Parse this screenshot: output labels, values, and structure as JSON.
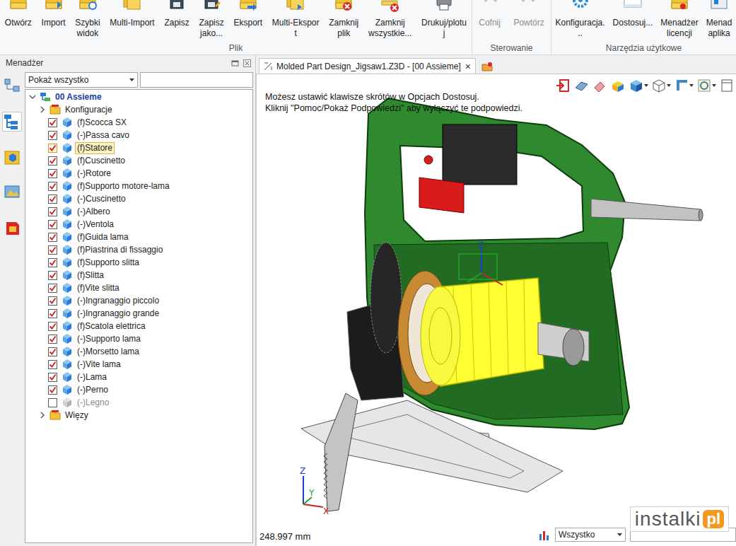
{
  "ribbon": {
    "groups": [
      {
        "label": "Plik",
        "buttons": [
          {
            "label": "Otwórz",
            "disabled": false
          },
          {
            "label": "Import",
            "disabled": false
          },
          {
            "label": "Szybki\nwidok",
            "disabled": false
          },
          {
            "label": "Multi-Import",
            "disabled": false
          },
          {
            "label": "Zapisz",
            "disabled": false
          },
          {
            "label": "Zapisz\njako...",
            "disabled": false
          },
          {
            "label": "Eksport",
            "disabled": false
          },
          {
            "label": "Multi-Ekspor\nt",
            "disabled": false
          },
          {
            "label": "Zamknij\nplik",
            "disabled": false
          },
          {
            "label": "Zamknij\nwszystkie...",
            "disabled": false
          },
          {
            "label": "Drukuj/plotu\nj",
            "disabled": false
          }
        ]
      },
      {
        "label": "Sterowanie",
        "buttons": [
          {
            "label": "Cofnij",
            "disabled": true
          },
          {
            "label": "Powtórz",
            "disabled": true
          }
        ]
      },
      {
        "label": "Narzędzia użytkowe",
        "buttons": [
          {
            "label": "Konfiguracja.\n..",
            "disabled": false
          },
          {
            "label": "Dostosuj...",
            "disabled": false
          },
          {
            "label": "Menadżer\nlicencji",
            "disabled": false
          },
          {
            "label": "Menad\naplika",
            "disabled": false
          }
        ]
      }
    ]
  },
  "manager": {
    "title": "Menadżer",
    "filter": "Pokaż wszystko",
    "tree": [
      {
        "label": "00 Assieme",
        "kind": "assembly",
        "expanded": true,
        "selected": false
      },
      {
        "label": "Konfiguracje",
        "kind": "folder",
        "expanded": false,
        "selected": false
      },
      {
        "label": "(f)Scocca SX",
        "kind": "part",
        "checked": true,
        "selected": false,
        "disabled": false
      },
      {
        "label": "(-)Passa cavo",
        "kind": "part",
        "checked": true,
        "selected": false,
        "disabled": false
      },
      {
        "label": "(f)Statore",
        "kind": "part",
        "checked": true,
        "selected": true,
        "disabled": false
      },
      {
        "label": "(f)Cuscinetto",
        "kind": "part",
        "checked": true,
        "selected": false,
        "disabled": false
      },
      {
        "label": "(-)Rotore",
        "kind": "part",
        "checked": true,
        "selected": false,
        "disabled": false
      },
      {
        "label": "(f)Supporto motore-lama",
        "kind": "part",
        "checked": true,
        "selected": false,
        "disabled": false
      },
      {
        "label": "(-)Cuscinetto",
        "kind": "part",
        "checked": true,
        "selected": false,
        "disabled": false
      },
      {
        "label": "(-)Albero",
        "kind": "part",
        "checked": true,
        "selected": false,
        "disabled": false
      },
      {
        "label": "(-)Ventola",
        "kind": "part",
        "checked": true,
        "selected": false,
        "disabled": false
      },
      {
        "label": "(f)Guida lama",
        "kind": "part",
        "checked": true,
        "selected": false,
        "disabled": false
      },
      {
        "label": "(f)Piastrina di fissaggio",
        "kind": "part",
        "checked": true,
        "selected": false,
        "disabled": false
      },
      {
        "label": "(f)Supporto slitta",
        "kind": "part",
        "checked": true,
        "selected": false,
        "disabled": false
      },
      {
        "label": "(f)Slitta",
        "kind": "part",
        "checked": true,
        "selected": false,
        "disabled": false
      },
      {
        "label": "(f)Vite slitta",
        "kind": "part",
        "checked": true,
        "selected": false,
        "disabled": false
      },
      {
        "label": "(-)Ingranaggio piccolo",
        "kind": "part",
        "checked": true,
        "selected": false,
        "disabled": false
      },
      {
        "label": "(-)Ingranaggio grande",
        "kind": "part",
        "checked": true,
        "selected": false,
        "disabled": false
      },
      {
        "label": "(f)Scatola elettrica",
        "kind": "part",
        "checked": true,
        "selected": false,
        "disabled": false
      },
      {
        "label": "(-)Supporto lama",
        "kind": "part",
        "checked": true,
        "selected": false,
        "disabled": false
      },
      {
        "label": "(-)Morsetto lama",
        "kind": "part",
        "checked": true,
        "selected": false,
        "disabled": false
      },
      {
        "label": "(-)Vite lama",
        "kind": "part",
        "checked": true,
        "selected": false,
        "disabled": false
      },
      {
        "label": "(-)Lama",
        "kind": "part",
        "checked": true,
        "selected": false,
        "disabled": false
      },
      {
        "label": "(-)Perno",
        "kind": "part",
        "checked": true,
        "selected": false,
        "disabled": false
      },
      {
        "label": "(-)Legno",
        "kind": "part",
        "checked": false,
        "selected": false,
        "disabled": true
      },
      {
        "label": "Więzy",
        "kind": "folder",
        "expanded": false,
        "selected": false
      }
    ]
  },
  "document": {
    "tabs": [
      {
        "label": "Molded Part Design_Jigsaw1.Z3D - [00 Assieme]",
        "close": "×",
        "selected": true
      }
    ]
  },
  "viewport": {
    "hints": [
      "Możesz ustawić klawisze skrótów w Opcjach Dostosuj.",
      "Kliknij \"Pomoc/Pokaż Podpowiedzi\" aby wyłączyć te podpowiedzi."
    ],
    "gizmo": {
      "label": "Z"
    },
    "triad": {
      "z": "Z",
      "x": "X",
      "y": "Y"
    },
    "dimension": "248.997 mm",
    "filter": "Wszystko"
  },
  "watermark": {
    "brand": "instalki",
    "suffix": "pl"
  }
}
